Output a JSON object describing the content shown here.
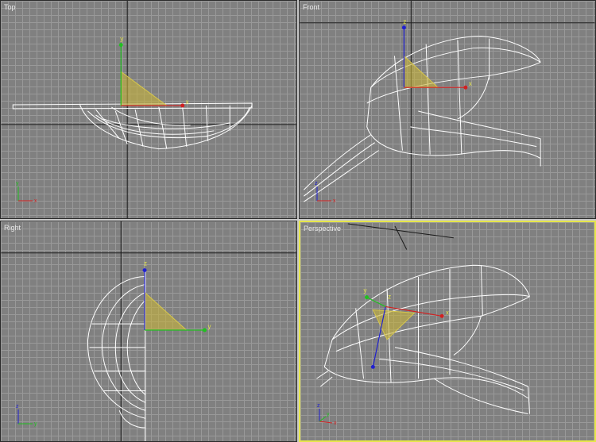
{
  "viewports": {
    "top": {
      "label": "Top"
    },
    "front": {
      "label": "Front"
    },
    "right": {
      "label": "Right"
    },
    "perspective": {
      "label": "Perspective"
    }
  },
  "axes": {
    "x": "x",
    "y": "y",
    "z": "z"
  },
  "colors": {
    "viewport_bg": "#808080",
    "grid": "#999999",
    "wire": "#ffffff",
    "active_border": "#e6e64a",
    "gizmo_fill": "#c8b43a",
    "axis_x": "#d22020",
    "axis_y": "#20c020",
    "axis_z": "#2020d0"
  }
}
